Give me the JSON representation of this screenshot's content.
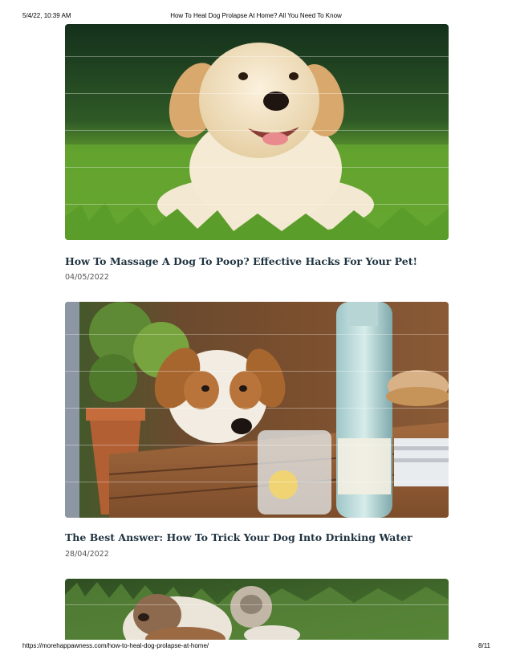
{
  "print_header": {
    "datetime": "5/4/22, 10:39 AM",
    "doc_title": "How To Heal Dog Prolapse At Home? All You Need To Know"
  },
  "posts": [
    {
      "title": "How To Massage A Dog To Poop? Effective Hacks For Your Pet!",
      "date": "04/05/2022"
    },
    {
      "title": "The Best Answer: How To Trick Your Dog Into Drinking Water",
      "date": "28/04/2022"
    }
  ],
  "print_footer": {
    "url": "https://morehappawness.com/how-to-heal-dog-prolapse-at-home/",
    "page": "8/11"
  }
}
